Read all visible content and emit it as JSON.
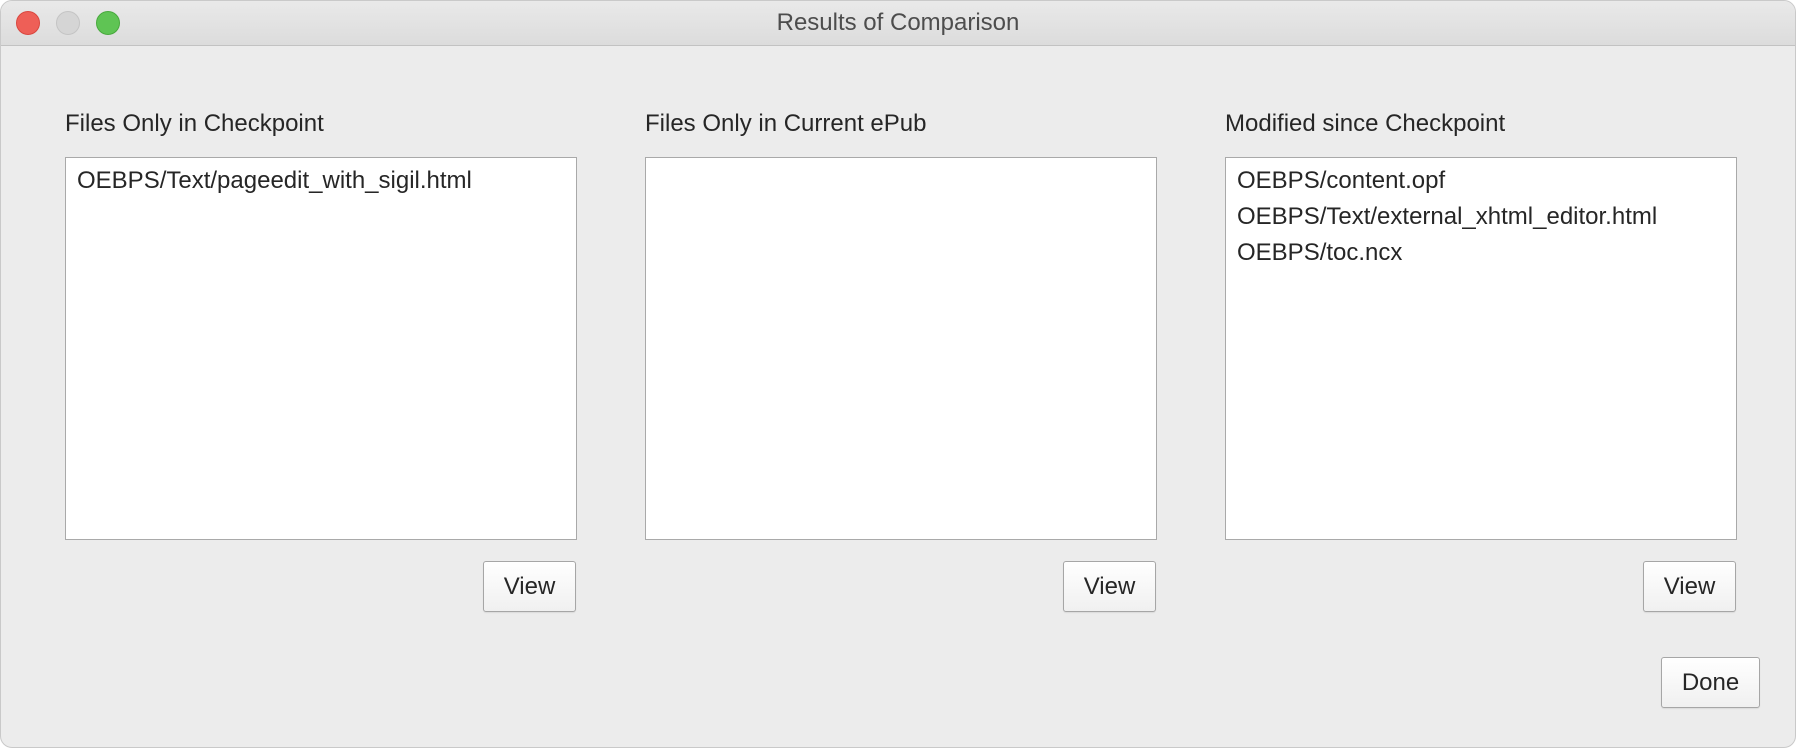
{
  "window": {
    "title": "Results of Comparison"
  },
  "panels": [
    {
      "label": "Files Only in Checkpoint",
      "items": [
        "OEBPS/Text/pageedit_with_sigil.html"
      ],
      "view_label": "View"
    },
    {
      "label": "Files Only in Current ePub",
      "items": [],
      "view_label": "View"
    },
    {
      "label": "Modified since Checkpoint",
      "items": [
        "OEBPS/content.opf",
        "OEBPS/Text/external_xhtml_editor.html",
        "OEBPS/toc.ncx"
      ],
      "view_label": "View"
    }
  ],
  "footer": {
    "done_label": "Done"
  },
  "colors": {
    "close": "#ee5f57",
    "minimize": "#d5d5d5",
    "zoom": "#5fc454",
    "window_bg": "#ececec"
  }
}
